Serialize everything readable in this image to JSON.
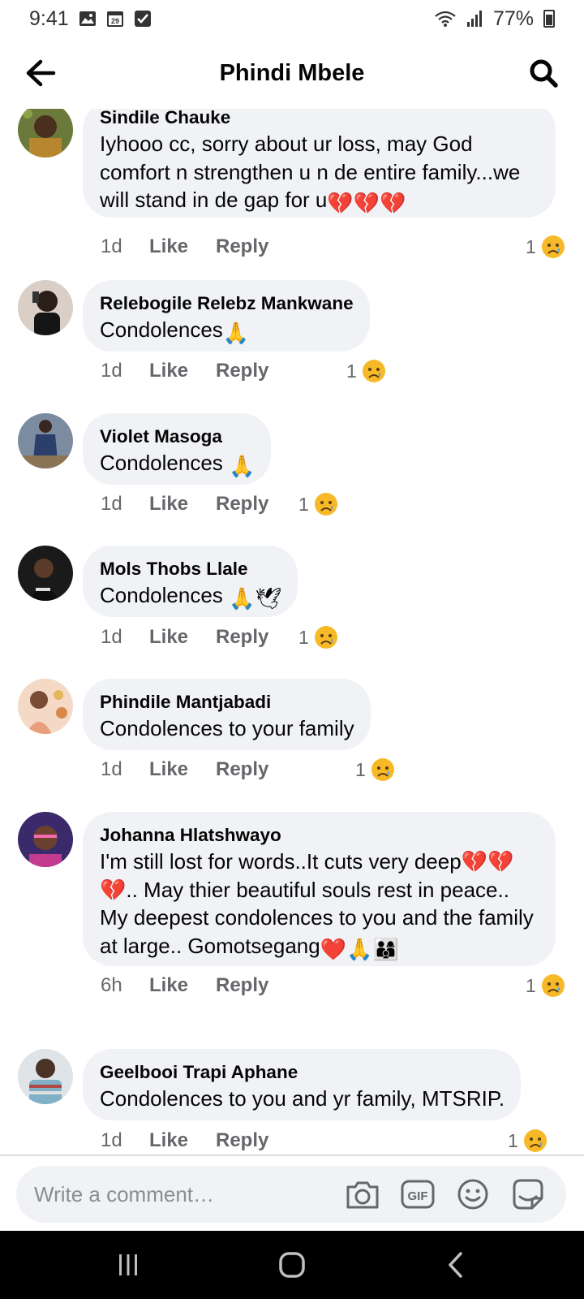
{
  "status_bar": {
    "time": "9:41",
    "battery": "77%",
    "calendar_day": "29"
  },
  "header": {
    "title": "Phindi Mbele"
  },
  "comments": [
    {
      "name": "Sindile Chauke",
      "text": "Iyhooo cc, sorry about ur loss, may God comfort n strengthen u n de entire family...we will stand in de gap for u",
      "emoji": "💔💔💔",
      "time": "1d",
      "like": "Like",
      "reply": "Reply",
      "reactions": "1"
    },
    {
      "name": "Relebogile Relebz Mankwane",
      "text": "Condolences",
      "emoji": "🙏",
      "time": "1d",
      "like": "Like",
      "reply": "Reply",
      "reactions": "1"
    },
    {
      "name": "Violet Masoga",
      "text": "Condolences ",
      "emoji": "🙏",
      "time": "1d",
      "like": "Like",
      "reply": "Reply",
      "reactions": "1"
    },
    {
      "name": "Mols Thobs Llale",
      "text": "Condolences ",
      "emoji": "🙏🕊",
      "time": "1d",
      "like": "Like",
      "reply": "Reply",
      "reactions": "1"
    },
    {
      "name": "Phindile Mantjabadi",
      "text": "Condolences to your family",
      "emoji": "",
      "time": "1d",
      "like": "Like",
      "reply": "Reply",
      "reactions": "1"
    },
    {
      "name": "Johanna Hlatshwayo",
      "text": "I'm still lost for words..It cuts very deep💔💔💔.. May thier beautiful souls rest in peace.. My deepest condolences to you and the family at large.. Gomotsegang",
      "emoji": "❤️🙏👨‍👩‍👦",
      "time": "6h",
      "like": "Like",
      "reply": "Reply",
      "reactions": "1"
    },
    {
      "name": "Geelbooi Trapi Aphane",
      "text": "Condolences to you and yr family, MTSRIP.",
      "emoji": "",
      "time": "1d",
      "like": "Like",
      "reply": "Reply",
      "reactions": "1"
    }
  ],
  "composer": {
    "placeholder": "Write a comment…",
    "gif_label": "GIF"
  },
  "colors": {
    "bubble": "#f0f2f5",
    "meta_text": "#65676b",
    "reaction_sad": "#f7b928",
    "nav_bar": "#000000"
  }
}
